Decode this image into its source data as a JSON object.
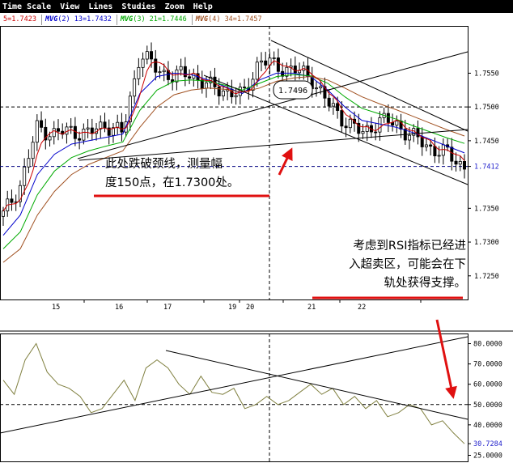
{
  "menu": [
    "Time Scale",
    "View",
    "Lines",
    "Studies",
    "Zoom",
    "Help"
  ],
  "legend": [
    {
      "prefix": "",
      "text": "5=1.7423",
      "color": "#cc0000"
    },
    {
      "prefix": "MVG",
      "text": "(2) 13=1.7432",
      "color": "#0000cc"
    },
    {
      "prefix": "MVG",
      "text": "(3) 21=1.7446",
      "color": "#00aa00"
    },
    {
      "prefix": "MVG",
      "text": "(4) 34=1.7457",
      "color": "#a05020"
    }
  ],
  "price_axis": {
    "ticks": [
      "1.7550",
      "1.7500",
      "1.7450",
      "1.7412",
      "1.7350",
      "1.7300",
      "1.7250"
    ],
    "current": "1.7412",
    "current_color": "#2222cc"
  },
  "rsi_axis": {
    "ticks": [
      "80.0000",
      "70.0000",
      "60.0000",
      "50.0000",
      "40.0000",
      "30.7284",
      "25.0000"
    ],
    "current": "30.7284",
    "current_color": "#2222cc"
  },
  "dates": [
    "15",
    "16",
    "17",
    "19",
    "20",
    "21",
    "22"
  ],
  "crosshair_label": "1.7496",
  "annotations": {
    "neckline_lines": [
      "此处跌破颈线，测量幅",
      "度150点，在1.7300处。"
    ],
    "rsi_lines": [
      "考虑到RSI指标已经进",
      "入超卖区，可能会在下",
      "轨处获得支撑。"
    ]
  },
  "colors": {
    "candle": "#000000",
    "ma5": "#cc0000",
    "ma13": "#0000cc",
    "ma21": "#00aa00",
    "ma34": "#a05020",
    "rsi": "#808040",
    "arrow": "#e01010",
    "dashed": "#000080"
  },
  "chart_data": [
    {
      "type": "candlestick",
      "xlabel": "",
      "ylabel": "",
      "ylim": [
        1.7215,
        1.762
      ],
      "x": [
        "15",
        "16",
        "17",
        "19",
        "20",
        "21",
        "22"
      ],
      "series": [
        {
          "values": [
            1.734,
            1.7385,
            1.747,
            1.746,
            1.7465,
            1.746,
            1.7475,
            1.746,
            1.758,
            1.7555,
            1.7545,
            1.755,
            1.753,
            1.7525,
            1.7515,
            1.757,
            1.756,
            1.7555,
            1.7545,
            1.7505,
            1.748,
            1.746,
            1.748,
            1.7475,
            1.7455,
            1.744,
            1.743,
            1.7412
          ]
        },
        {
          "name": "MVG(2) 13",
          "values": [
            1.731,
            1.734,
            1.74,
            1.743,
            1.7445,
            1.745,
            1.7455,
            1.746,
            1.752,
            1.7545,
            1.755,
            1.7548,
            1.754,
            1.753,
            1.752,
            1.754,
            1.755,
            1.755,
            1.7545,
            1.7525,
            1.75,
            1.748,
            1.7475,
            1.747,
            1.7462,
            1.7452,
            1.7442,
            1.7432
          ]
        },
        {
          "name": "MVG(3) 21",
          "values": [
            1.729,
            1.7315,
            1.737,
            1.7405,
            1.7425,
            1.7435,
            1.7442,
            1.7448,
            1.7495,
            1.7525,
            1.7538,
            1.754,
            1.7538,
            1.7532,
            1.7525,
            1.7535,
            1.7545,
            1.7548,
            1.7546,
            1.7535,
            1.7515,
            1.7498,
            1.749,
            1.7482,
            1.7472,
            1.7463,
            1.7454,
            1.7446
          ]
        },
        {
          "name": "MVG(4) 34",
          "values": [
            1.727,
            1.729,
            1.734,
            1.7375,
            1.74,
            1.7415,
            1.7425,
            1.7435,
            1.747,
            1.75,
            1.7518,
            1.7525,
            1.7528,
            1.7526,
            1.7522,
            1.7528,
            1.7538,
            1.7543,
            1.7545,
            1.754,
            1.7528,
            1.7515,
            1.7505,
            1.7496,
            1.7486,
            1.7476,
            1.7466,
            1.7457
          ]
        }
      ],
      "current_value": 1.7412,
      "crosshair_value": 1.7496
    },
    {
      "type": "line",
      "xlabel": "",
      "ylabel": "",
      "ylim": [
        22,
        85
      ],
      "x": [
        "15",
        "16",
        "17",
        "19",
        "20",
        "21",
        "22"
      ],
      "series": [
        {
          "values": [
            62,
            55,
            72,
            80,
            66,
            60,
            58,
            54,
            46,
            48,
            55,
            62,
            52,
            68,
            72,
            68,
            60,
            55,
            64,
            56,
            55,
            58,
            48,
            50,
            54,
            50,
            52,
            56,
            60,
            55,
            58,
            50,
            54,
            48,
            52,
            44,
            46,
            50,
            48,
            40,
            42,
            36,
            30.7
          ]
        }
      ],
      "current_value": 30.7284
    }
  ]
}
